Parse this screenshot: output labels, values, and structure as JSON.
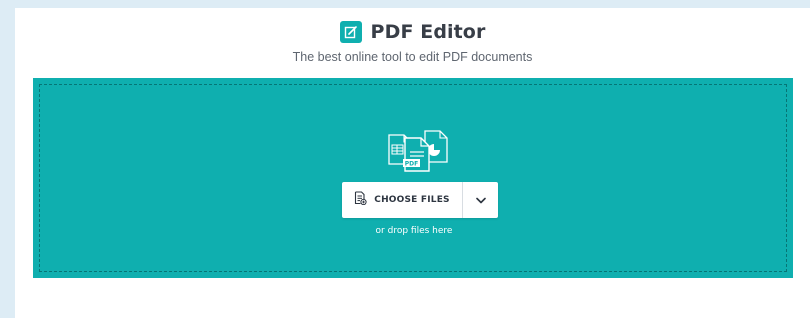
{
  "app": {
    "title": "PDF Editor",
    "subtitle": "The best online tool to edit PDF documents"
  },
  "upload": {
    "choose_label": "CHOOSE FILES",
    "drop_hint": "or drop files here"
  },
  "colors": {
    "accent": "#0fafaf",
    "page_background": "#ddecf5",
    "panel_background": "#ffffff",
    "title_text": "#383e47"
  },
  "icons": {
    "title": "edit-document-icon",
    "illustration": "documents-illustration-icon",
    "choose": "add-file-icon",
    "dropdown": "chevron-down-icon"
  }
}
